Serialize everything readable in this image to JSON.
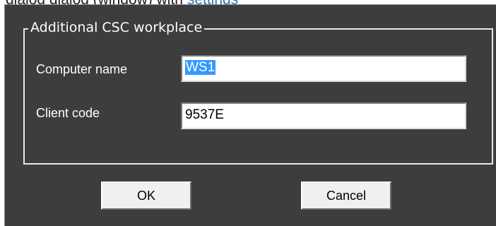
{
  "top_strip": {
    "text": "dialog dialog (window) with",
    "link_text": "settings"
  },
  "dialog": {
    "group_title": "Additional CSC workplace",
    "fields": [
      {
        "label": "Computer name",
        "value": "WS1",
        "selected": true
      },
      {
        "label": "Client code",
        "value": "9537E",
        "selected": false
      }
    ],
    "buttons": {
      "ok_label": "OK",
      "cancel_label": "Cancel"
    }
  },
  "colors": {
    "dialog_bg": "#3d3d3d",
    "selection": "#3399ff",
    "button_face": "#f0f0f0"
  }
}
